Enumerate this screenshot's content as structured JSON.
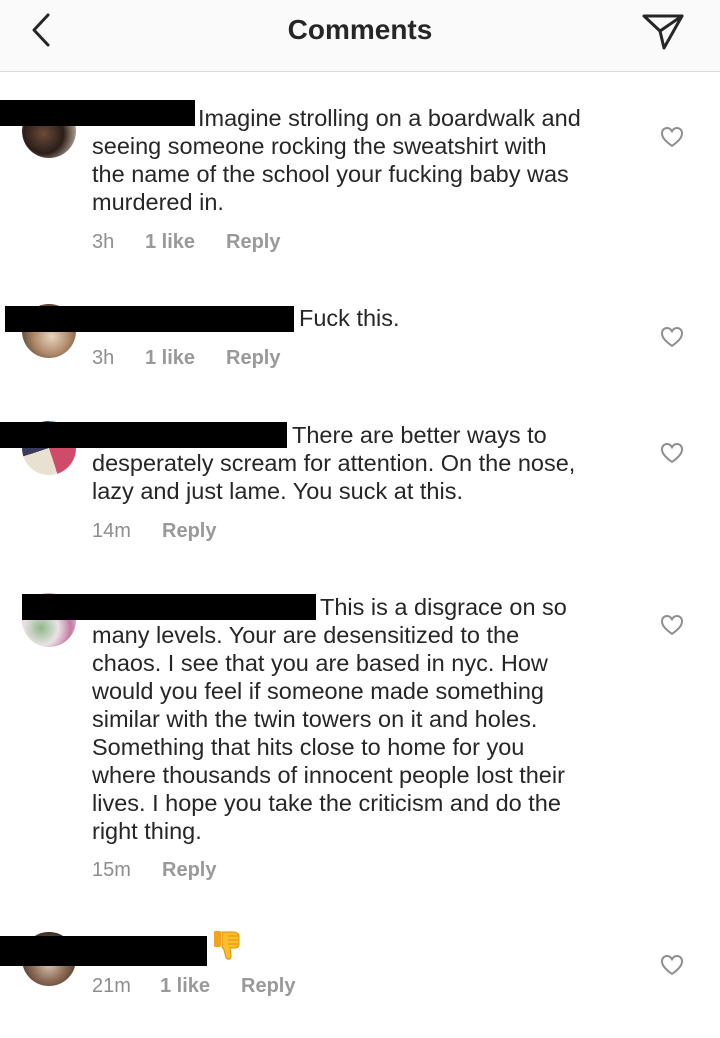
{
  "header": {
    "title": "Comments",
    "back_icon": "chevron-left-icon",
    "send_icon": "send-icon"
  },
  "comments": [
    {
      "lines": [
        "Imagine strolling on a boardwalk and",
        "seeing someone rocking the sweatshirt with",
        "the name of the school your fucking baby was",
        "murdered in."
      ],
      "time": "3h",
      "likes": "1 like",
      "reply": "Reply"
    },
    {
      "lines": [
        "Fuck this."
      ],
      "time": "3h",
      "likes": "1 like",
      "reply": "Reply"
    },
    {
      "lines": [
        "There are better ways to",
        "desperately scream for attention. On the nose,",
        "lazy and just lame. You suck at this."
      ],
      "time": "14m",
      "reply": "Reply"
    },
    {
      "lines": [
        "This is a disgrace on so",
        "many levels. Your are desensitized to the",
        "chaos. I see that you are based in nyc. How",
        "would you feel if someone made something",
        "similar with the twin towers on it and holes.",
        "Something that hits close to home for you",
        "where thousands of innocent people lost their",
        "lives. I hope you take the criticism and do the",
        "right thing."
      ],
      "time": "15m",
      "reply": "Reply"
    },
    {
      "emoji": "thumbs-down-emoji",
      "time": "21m",
      "likes": "1 like",
      "reply": "Reply"
    }
  ],
  "colors": {
    "text": "#262626",
    "meta": "#8e8e8e",
    "header_bg": "#fafafa",
    "redaction": "#000000"
  }
}
